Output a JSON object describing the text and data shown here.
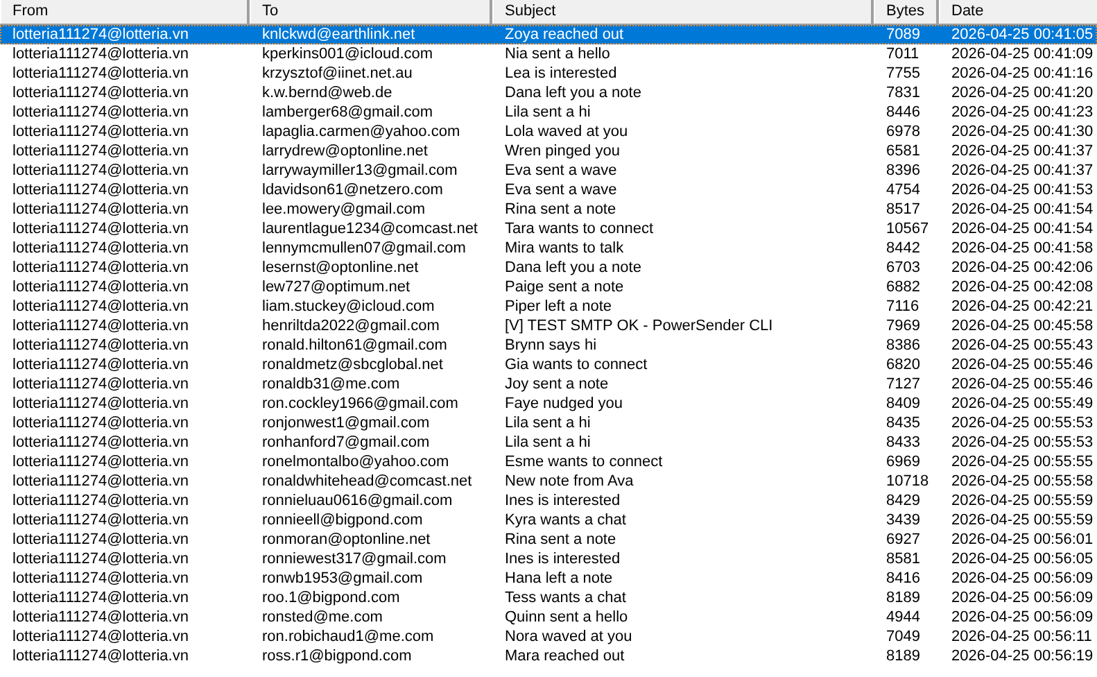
{
  "table": {
    "columns": [
      "From",
      "To",
      "Subject",
      "Bytes",
      "Date"
    ],
    "rows": [
      {
        "selected": true,
        "cells": [
          "lotteria111274@lotteria.vn",
          "knlckwd@earthlink.net",
          "Zoya reached out",
          "7089",
          "2026-04-25 00:41:05"
        ]
      },
      {
        "selected": false,
        "cells": [
          "lotteria111274@lotteria.vn",
          "kperkins001@icloud.com",
          "Nia sent a hello",
          "7011",
          "2026-04-25 00:41:09"
        ]
      },
      {
        "selected": false,
        "cells": [
          "lotteria111274@lotteria.vn",
          "krzysztof@iinet.net.au",
          "Lea is interested",
          "7755",
          "2026-04-25 00:41:16"
        ]
      },
      {
        "selected": false,
        "cells": [
          "lotteria111274@lotteria.vn",
          "k.w.bernd@web.de",
          "Dana left you a note",
          "7831",
          "2026-04-25 00:41:20"
        ]
      },
      {
        "selected": false,
        "cells": [
          "lotteria111274@lotteria.vn",
          "lamberger68@gmail.com",
          "Lila sent a hi",
          "8446",
          "2026-04-25 00:41:23"
        ]
      },
      {
        "selected": false,
        "cells": [
          "lotteria111274@lotteria.vn",
          "lapaglia.carmen@yahoo.com",
          "Lola waved at you",
          "6978",
          "2026-04-25 00:41:30"
        ]
      },
      {
        "selected": false,
        "cells": [
          "lotteria111274@lotteria.vn",
          "larrydrew@optonline.net",
          "Wren pinged you",
          "6581",
          "2026-04-25 00:41:37"
        ]
      },
      {
        "selected": false,
        "cells": [
          "lotteria111274@lotteria.vn",
          "larrywaymiller13@gmail.com",
          "Eva sent a wave",
          "8396",
          "2026-04-25 00:41:37"
        ]
      },
      {
        "selected": false,
        "cells": [
          "lotteria111274@lotteria.vn",
          "ldavidson61@netzero.com",
          "Eva sent a wave",
          "4754",
          "2026-04-25 00:41:53"
        ]
      },
      {
        "selected": false,
        "cells": [
          "lotteria111274@lotteria.vn",
          "lee.mowery@gmail.com",
          "Rina sent a note",
          "8517",
          "2026-04-25 00:41:54"
        ]
      },
      {
        "selected": false,
        "cells": [
          "lotteria111274@lotteria.vn",
          "laurentlague1234@comcast.net",
          "Tara wants to connect",
          "10567",
          "2026-04-25 00:41:54"
        ]
      },
      {
        "selected": false,
        "cells": [
          "lotteria111274@lotteria.vn",
          "lennymcmullen07@gmail.com",
          "Mira wants to talk",
          "8442",
          "2026-04-25 00:41:58"
        ]
      },
      {
        "selected": false,
        "cells": [
          "lotteria111274@lotteria.vn",
          "lesernst@optonline.net",
          "Dana left you a note",
          "6703",
          "2026-04-25 00:42:06"
        ]
      },
      {
        "selected": false,
        "cells": [
          "lotteria111274@lotteria.vn",
          "lew727@optimum.net",
          "Paige sent a note",
          "6882",
          "2026-04-25 00:42:08"
        ]
      },
      {
        "selected": false,
        "cells": [
          "lotteria111274@lotteria.vn",
          "liam.stuckey@icloud.com",
          "Piper left a note",
          "7116",
          "2026-04-25 00:42:21"
        ]
      },
      {
        "selected": false,
        "cells": [
          "lotteria111274@lotteria.vn",
          "henriltda2022@gmail.com",
          "[V] TEST SMTP OK - PowerSender CLI",
          "7969",
          "2026-04-25 00:45:58"
        ]
      },
      {
        "selected": false,
        "cells": [
          "lotteria111274@lotteria.vn",
          "ronald.hilton61@gmail.com",
          "Brynn says hi",
          "8386",
          "2026-04-25 00:55:43"
        ]
      },
      {
        "selected": false,
        "cells": [
          "lotteria111274@lotteria.vn",
          "ronaldmetz@sbcglobal.net",
          "Gia wants to connect",
          "6820",
          "2026-04-25 00:55:46"
        ]
      },
      {
        "selected": false,
        "cells": [
          "lotteria111274@lotteria.vn",
          "ronaldb31@me.com",
          "Joy sent a note",
          "7127",
          "2026-04-25 00:55:46"
        ]
      },
      {
        "selected": false,
        "cells": [
          "lotteria111274@lotteria.vn",
          "ron.cockley1966@gmail.com",
          "Faye nudged you",
          "8409",
          "2026-04-25 00:55:49"
        ]
      },
      {
        "selected": false,
        "cells": [
          "lotteria111274@lotteria.vn",
          "ronjonwest1@gmail.com",
          "Lila sent a hi",
          "8435",
          "2026-04-25 00:55:53"
        ]
      },
      {
        "selected": false,
        "cells": [
          "lotteria111274@lotteria.vn",
          "ronhanford7@gmail.com",
          "Lila sent a hi",
          "8433",
          "2026-04-25 00:55:53"
        ]
      },
      {
        "selected": false,
        "cells": [
          "lotteria111274@lotteria.vn",
          "ronelmontalbo@yahoo.com",
          "Esme wants to connect",
          "6969",
          "2026-04-25 00:55:55"
        ]
      },
      {
        "selected": false,
        "cells": [
          "lotteria111274@lotteria.vn",
          "ronaldwhitehead@comcast.net",
          "New note from Ava",
          "10718",
          "2026-04-25 00:55:58"
        ]
      },
      {
        "selected": false,
        "cells": [
          "lotteria111274@lotteria.vn",
          "ronnieluau0616@gmail.com",
          "Ines is interested",
          "8429",
          "2026-04-25 00:55:59"
        ]
      },
      {
        "selected": false,
        "cells": [
          "lotteria111274@lotteria.vn",
          "ronnieell@bigpond.com",
          "Kyra wants a chat",
          "3439",
          "2026-04-25 00:55:59"
        ]
      },
      {
        "selected": false,
        "cells": [
          "lotteria111274@lotteria.vn",
          "ronmoran@optonline.net",
          "Rina sent a note",
          "6927",
          "2026-04-25 00:56:01"
        ]
      },
      {
        "selected": false,
        "cells": [
          "lotteria111274@lotteria.vn",
          "ronniewest317@gmail.com",
          "Ines is interested",
          "8581",
          "2026-04-25 00:56:05"
        ]
      },
      {
        "selected": false,
        "cells": [
          "lotteria111274@lotteria.vn",
          "ronwb1953@gmail.com",
          "Hana left a note",
          "8416",
          "2026-04-25 00:56:09"
        ]
      },
      {
        "selected": false,
        "cells": [
          "lotteria111274@lotteria.vn",
          "roo.1@bigpond.com",
          "Tess wants a chat",
          "8189",
          "2026-04-25 00:56:09"
        ]
      },
      {
        "selected": false,
        "cells": [
          "lotteria111274@lotteria.vn",
          "ronsted@me.com",
          "Quinn sent a hello",
          "4944",
          "2026-04-25 00:56:09"
        ]
      },
      {
        "selected": false,
        "cells": [
          "lotteria111274@lotteria.vn",
          "ron.robichaud1@me.com",
          "Nora waved at you",
          "7049",
          "2026-04-25 00:56:11"
        ]
      },
      {
        "selected": false,
        "cells": [
          "lotteria111274@lotteria.vn",
          "ross.r1@bigpond.com",
          "Mara reached out",
          "8189",
          "2026-04-25 00:56:19"
        ]
      }
    ]
  }
}
